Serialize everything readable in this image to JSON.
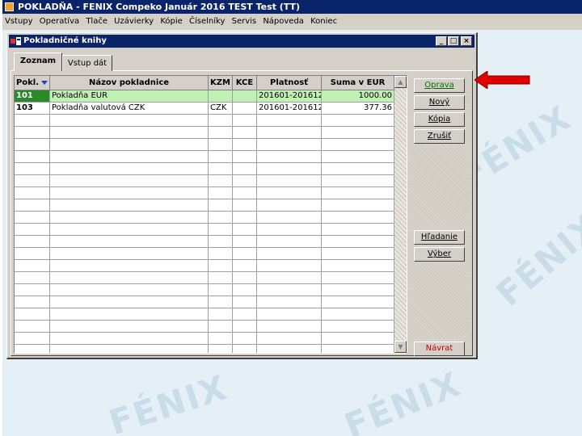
{
  "app": {
    "title": "POKLADŇA - FENIX Compeko  Január 2016   TEST Test  (TT)"
  },
  "menu": [
    "Vstupy",
    "Operatíva",
    "Tlače",
    "Uzávierky",
    "Kópie",
    "Číselníky",
    "Servis",
    "Nápoveda",
    "Koniec"
  ],
  "window": {
    "title": "Pokladničné knihy",
    "controls": [
      "_",
      "□",
      "×"
    ]
  },
  "tabs": [
    {
      "label": "Zoznam",
      "active": true
    },
    {
      "label": "Vstup dát",
      "active": false
    }
  ],
  "table": {
    "columns": [
      "Pokl.",
      "Názov pokladnice",
      "KZM",
      "KCE",
      "Platnosť",
      "Suma v EUR"
    ],
    "rows": [
      {
        "code": "101",
        "name": "Pokladňa EUR",
        "kzm": "",
        "kce": "",
        "valid": "201601-201612",
        "sum": "1000.00",
        "selected": true
      },
      {
        "code": "103",
        "name": "Pokladňa valutová CZK",
        "kzm": "CZK",
        "kce": "",
        "valid": "201601-201612",
        "sum": "377.36",
        "selected": false
      }
    ]
  },
  "buttons": {
    "oprava": "Oprava",
    "novy": "Nový",
    "kopia": "Kópia",
    "zrusit": "Zrušiť",
    "hladanie": "Hľadanie",
    "vyber": "Výber",
    "navrat": "Návrat"
  },
  "watermark": "FÉNIX",
  "colors": {
    "title_bar": "#0a246a",
    "selected_row": "#c0f0b4",
    "selected_code": "#2a8a2a",
    "annotation_arrow": "#e00000"
  }
}
